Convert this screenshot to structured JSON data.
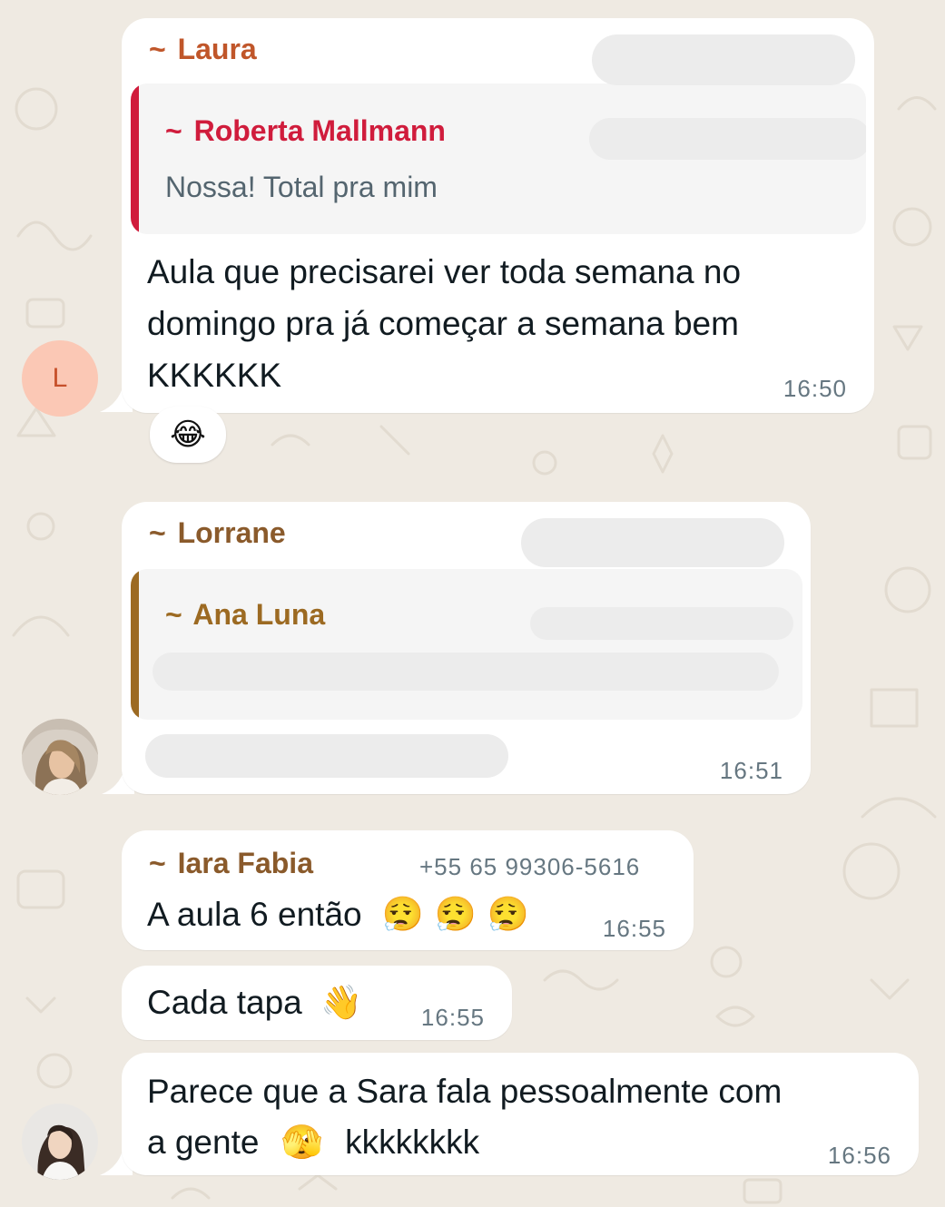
{
  "colors": {
    "background": "#efeae2",
    "bubble": "#ffffff",
    "laura": "#c0562a",
    "roberta": "#d01c3c",
    "lorrane": "#8a5a2b",
    "ana": "#9c6a22",
    "iara": "#8a5a2b",
    "timestamp": "#667781"
  },
  "messages": [
    {
      "sender": "Laura",
      "quote": {
        "sender": "Roberta Mallmann",
        "text": "Nossa! Total pra mim"
      },
      "lines": [
        "Aula que precisarei ver toda semana no",
        "domingo pra já começar a semana bem",
        "KKKKKK"
      ],
      "time": "16:50",
      "avatar_letter": "L",
      "reaction": "😂"
    },
    {
      "sender": "Lorrane",
      "quote": {
        "sender": "Ana Luna"
      },
      "time": "16:51",
      "avatar_icon": "profile-photo-lorrane"
    },
    {
      "sender": "Iara Fabia",
      "phone": "+55 65 99306-5616",
      "text": "A aula 6 então",
      "emojis": "😮‍💨 😮‍💨 😮‍💨",
      "time": "16:55"
    },
    {
      "text": "Cada tapa",
      "emojis": "👋",
      "time": "16:55"
    },
    {
      "line1": "Parece que a Sara fala pessoalmente com",
      "line2_text": "a gente",
      "line2_emoji": "🫣",
      "line2_suffix": "kkkkkkkk",
      "time": "16:56",
      "avatar_icon": "profile-photo-iara"
    }
  ]
}
